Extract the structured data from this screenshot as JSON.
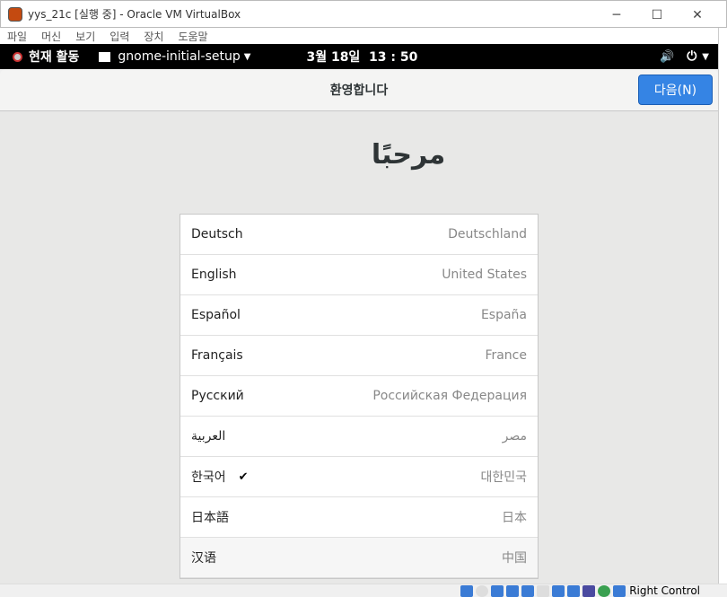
{
  "window": {
    "title": "yys_21c [실행 중] - Oracle VM VirtualBox",
    "minimize": "─",
    "maximize": "☐",
    "close": "✕"
  },
  "menu": [
    "파일",
    "머신",
    "보기",
    "입력",
    "장치",
    "도움말"
  ],
  "topbar": {
    "activities": "현재 활동",
    "app": "gnome-initial-setup",
    "clock": "3월 18일  13 : 50"
  },
  "header": {
    "title": "환영합니다",
    "next": "다음(N)"
  },
  "welcome": "مرحبًا",
  "languages": [
    {
      "lang": "Deutsch",
      "country": "Deutschland"
    },
    {
      "lang": "English",
      "country": "United States"
    },
    {
      "lang": "Español",
      "country": "España"
    },
    {
      "lang": "Français",
      "country": "France"
    },
    {
      "lang": "Русский",
      "country": "Российская Федерация"
    },
    {
      "lang": "العربية",
      "country": "مصر"
    },
    {
      "lang": "한국어",
      "country": "대한민국",
      "selected": true,
      "check": "✔"
    },
    {
      "lang": "日本語",
      "country": "日本"
    },
    {
      "lang": "汉语",
      "country": "中国"
    }
  ],
  "statusbar": {
    "host_key": "Right Control"
  }
}
